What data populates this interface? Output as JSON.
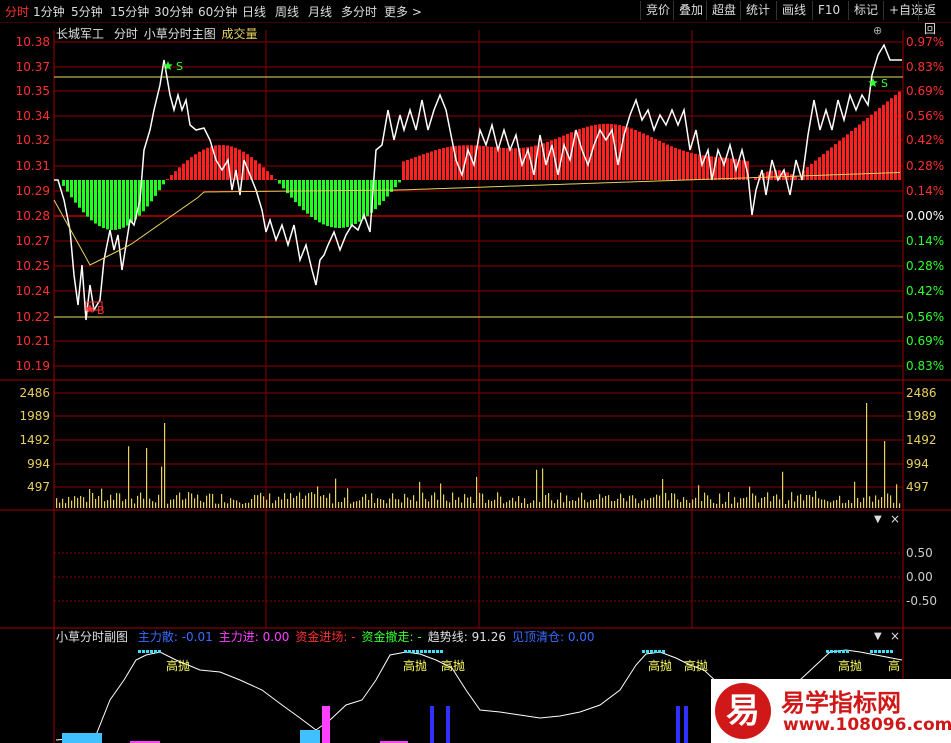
{
  "toolbar": {
    "periods": [
      "分时",
      "1分钟",
      "5分钟",
      "15分钟",
      "30分钟",
      "60分钟",
      "日线",
      "周线",
      "月线",
      "多分时",
      "更多"
    ],
    "right_buttons": [
      "竞价",
      "叠加",
      "超盘",
      "统计",
      "画线",
      "F10",
      "标记",
      "+自选",
      "返回"
    ]
  },
  "header": {
    "stock_name": "长城军工",
    "mode": "分时",
    "indicator": "小草分时主图",
    "volume_label": "成交量"
  },
  "price_axis": {
    "left": [
      "10.38",
      "10.37",
      "10.35",
      "10.34",
      "10.32",
      "10.31",
      "10.29",
      "10.28",
      "10.27",
      "10.25",
      "10.24",
      "10.22",
      "10.21",
      "10.19"
    ],
    "right": [
      "0.97%",
      "0.83%",
      "0.69%",
      "0.56%",
      "0.42%",
      "0.28%",
      "0.14%",
      "0.00%",
      "0.14%",
      "0.28%",
      "0.42%",
      "0.56%",
      "0.69%",
      "0.83%"
    ]
  },
  "volume_axis": [
    "2486",
    "1989",
    "1492",
    "994",
    "497"
  ],
  "middle_axis": [
    "0.50",
    "0.00",
    "-0.50"
  ],
  "markers": {
    "buy": "B",
    "sell": "S"
  },
  "sub_panel": {
    "name": "小草分时副图",
    "legend": [
      {
        "label": "主力散:",
        "value": "-0.01",
        "color": "#3a6cff"
      },
      {
        "label": "主力进:",
        "value": "0.00",
        "color": "#ff40ff"
      },
      {
        "label": "资金进场:",
        "value": "-",
        "color": "#ff3030"
      },
      {
        "label": "资金撤走:",
        "value": "-",
        "color": "#30ff30"
      },
      {
        "label": "趋势线:",
        "value": "91.26",
        "color": "#e0e0e0"
      },
      {
        "label": "见顶清仓:",
        "value": "0.00",
        "color": "#3a6cff"
      }
    ],
    "top_labels": [
      "高抛",
      "高抛",
      "高抛",
      "高抛",
      "高抛",
      "高抛",
      "高"
    ]
  },
  "watermark": {
    "icon_char": "易",
    "title": "易学指标网",
    "url": "www.108096.com"
  },
  "colors": {
    "grid": "#8b0000",
    "up": "#ff2020",
    "down": "#20ff20",
    "price": "#ffffff",
    "avg": "#e8d060",
    "volume": "#e8d060"
  }
}
